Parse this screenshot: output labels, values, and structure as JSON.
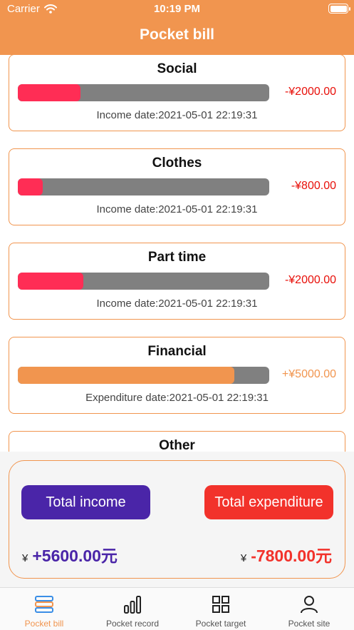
{
  "status_bar": {
    "carrier": "Carrier",
    "time": "10:19 PM"
  },
  "header": {
    "title": "Pocket bill"
  },
  "colors": {
    "accent": "#f1954f",
    "expense": "#ff2d55",
    "income_fill": "#f1954f",
    "track": "#808080",
    "income_button": "#4a25a8",
    "expenditure_button": "#f2322b"
  },
  "records": [
    {
      "name": "Social",
      "amount": "-¥2000.00",
      "date_label": "Income date:2021-05-01 22:19:31",
      "progress": 0.25,
      "kind": "expense"
    },
    {
      "name": "Clothes",
      "amount": "-¥800.00",
      "date_label": "Income date:2021-05-01 22:19:31",
      "progress": 0.1,
      "kind": "expense"
    },
    {
      "name": "Part time",
      "amount": "-¥2000.00",
      "date_label": "Income date:2021-05-01 22:19:31",
      "progress": 0.26,
      "kind": "expense"
    },
    {
      "name": "Financial",
      "amount": "+¥5000.00",
      "date_label": "Expenditure date:2021-05-01 22:19:31",
      "progress": 0.86,
      "kind": "income"
    },
    {
      "name": "Other",
      "amount": "",
      "date_label": "",
      "progress": 0,
      "kind": "expense"
    }
  ],
  "summary": {
    "income_button": "Total income",
    "expenditure_button": "Total expenditure",
    "currency_symbol": "¥",
    "total_income": "+5600.00元",
    "total_expenditure": "-7800.00元"
  },
  "tabs": [
    {
      "label": "Pocket bill",
      "icon": "list-icon",
      "active": true
    },
    {
      "label": "Pocket record",
      "icon": "bar-chart-icon",
      "active": false
    },
    {
      "label": "Pocket target",
      "icon": "grid-icon",
      "active": false
    },
    {
      "label": "Pocket site",
      "icon": "person-icon",
      "active": false
    }
  ]
}
